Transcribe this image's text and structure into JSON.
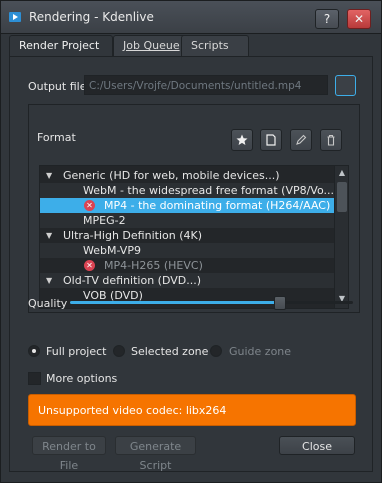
{
  "window": {
    "title": "Rendering - Kdenlive",
    "help_label": "?",
    "close_label": "✕"
  },
  "tabs": [
    {
      "label": "Render Project"
    },
    {
      "label": "Job Queue"
    },
    {
      "label": "Scripts"
    }
  ],
  "output": {
    "label": "Output file",
    "value": "C:/Users/Vrojfe/Documents/untitled.mp4"
  },
  "format": {
    "label": "Format",
    "buttons": [
      "star-icon",
      "new-document-icon",
      "edit-icon",
      "delete-icon"
    ],
    "rows": [
      {
        "kind": "group",
        "text": "Generic (HD for web, mobile devices...)"
      },
      {
        "kind": "item",
        "text": "WebM - the widespread free format (VP8/Vo..."
      },
      {
        "kind": "item",
        "text": "MP4 - the dominating format (H264/AAC)",
        "error": true,
        "selected": true
      },
      {
        "kind": "item",
        "text": "MPEG-2"
      },
      {
        "kind": "group",
        "text": "Ultra-High Definition (4K)"
      },
      {
        "kind": "item",
        "text": "WebM-VP9"
      },
      {
        "kind": "item",
        "text": "MP4-H265 (HEVC)",
        "error": true,
        "disabled": true
      },
      {
        "kind": "group",
        "text": "Old-TV definition (DVD...)"
      },
      {
        "kind": "item",
        "text": "VOB (DVD)"
      }
    ]
  },
  "quality": {
    "label": "Quality",
    "level": 0.74
  },
  "zone": {
    "full_project": "Full project",
    "selected_zone": "Selected zone",
    "guide_zone": "Guide zone"
  },
  "more_options": "More options",
  "warning": "Unsupported video codec: libx264",
  "buttons": {
    "render": "Render to File",
    "generate": "Generate Script",
    "close": "Close"
  },
  "colors": {
    "accent": "#3daee9",
    "warning": "#f67400",
    "error": "#da4453"
  }
}
